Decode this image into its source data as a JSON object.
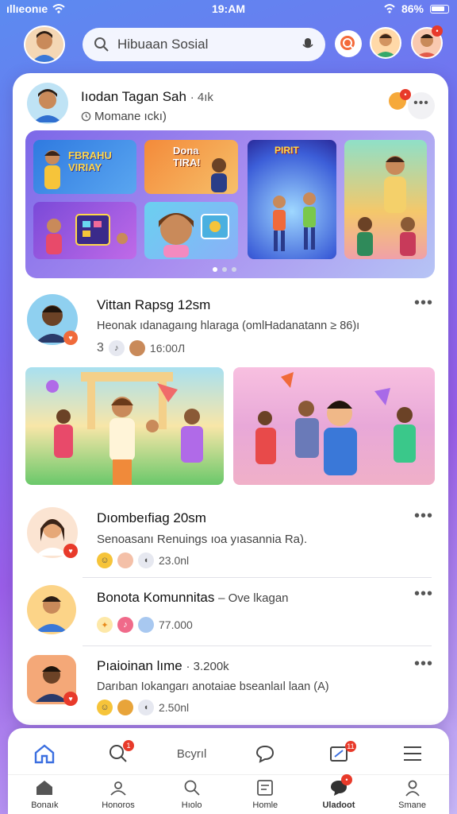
{
  "status_bar": {
    "carrier": "ıllıeonıe",
    "time": "19:AM",
    "battery": "86%"
  },
  "header": {
    "search_placeholder": "Hibuaan Sosial"
  },
  "posts": [
    {
      "name": "Iıodan Tagan Sah",
      "time": "· 4ık",
      "sub": "Momane ıckı)"
    },
    {
      "name": "Vittan Rapsg 12sm",
      "text": "Heonak ıdanagaıng hlaraga (omlHadanatann ≥ 86)ı",
      "meta_count": "3",
      "meta_views": "16:00Л"
    },
    {
      "name": "Dıombeıfiag 20sm",
      "text": "Senoasanı Renuings ıoa yıasannia Ra).",
      "meta_views": "23.0nl"
    },
    {
      "name": "Bonota Komunnitas",
      "suffix": "– Ove lkagan",
      "meta_views": "77.000"
    },
    {
      "name": "Pıaioinan lıme",
      "suffix": "· 3.200k",
      "text": "Darıban Iokangarı anotaiae bseanlaıl laan (A)",
      "meta_views": "2.50nl"
    }
  ],
  "gallery": {
    "tile1_text": "FBRAHU VIRIAY",
    "tile2_text": "Dona TIRA!",
    "tile3_text": "PIRIT"
  },
  "bottom_nav": {
    "row1_center_label": "Bcyrıl",
    "items": [
      {
        "label": "Bonaık"
      },
      {
        "label": "Honoros"
      },
      {
        "label": "Hıolo"
      },
      {
        "label": "Homle"
      },
      {
        "label": "Uladoot"
      },
      {
        "label": "Smane"
      }
    ]
  },
  "colors": {
    "accent": "#3b6fe0",
    "badge": "#e83a2a",
    "card": "#ffffff"
  }
}
